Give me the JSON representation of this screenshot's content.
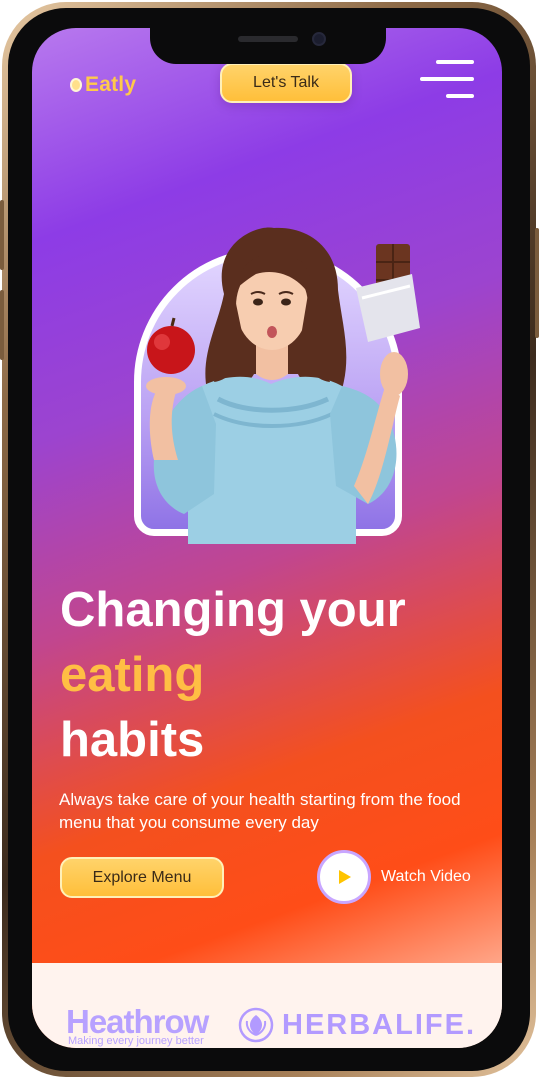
{
  "header": {
    "logo_text": "Eatly",
    "cta_label": "Let's Talk"
  },
  "hero": {
    "headline_line1": "Changing your",
    "headline_accent": "eating",
    "headline_line3": "habits",
    "subtitle": "Always take care of your health starting from the food menu that you consume every day",
    "explore_label": "Explore Menu",
    "watch_label": "Watch Video"
  },
  "partners": {
    "heathrow_name": "Heathrow",
    "heathrow_tagline": "Making every journey better",
    "herbalife_name": "HERBALIFE."
  },
  "colors": {
    "accent_yellow": "#ffbe44",
    "button_yellow": "#ffc94a",
    "purple": "#8d3ce6",
    "orange": "#ff4d18",
    "partner_logo": "#b29aff"
  },
  "icons": {
    "menu": "hamburger-menu-icon",
    "play": "play-icon",
    "logo": "egg-logo-icon"
  }
}
